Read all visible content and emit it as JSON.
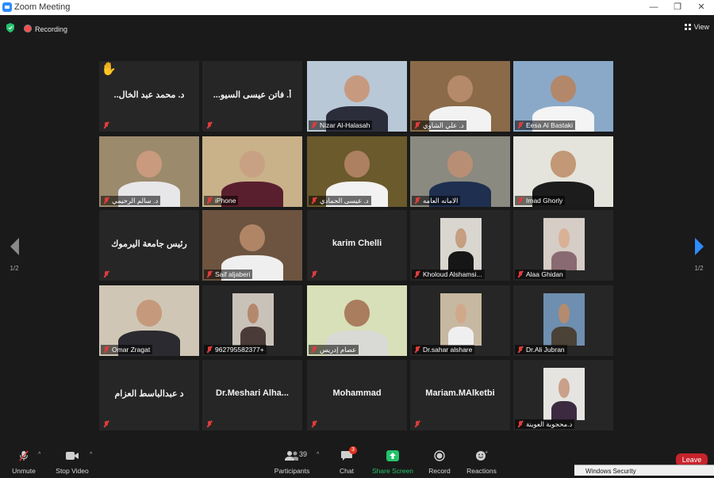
{
  "window": {
    "title": "Zoom Meeting",
    "controls": [
      "—",
      "❐",
      "✕"
    ]
  },
  "topbar": {
    "recording": "Recording",
    "view": "View"
  },
  "pager": {
    "left": "1/2",
    "right": "1/2"
  },
  "tiles": [
    {
      "name": "..د. محمد عبد الخال",
      "label": "",
      "kind": "name",
      "hand": true
    },
    {
      "name": "...أ. فاتن عيسى السيو",
      "label": "",
      "kind": "name"
    },
    {
      "name": "",
      "label": "Nizar Al-Halasah",
      "kind": "video",
      "bg": "#b9c8d6",
      "skin": "#c79a80",
      "suit": "#2b2e3a"
    },
    {
      "name": "",
      "label": "د. علي الشاوي",
      "kind": "video",
      "bg": "#8a6a48",
      "skin": "#b58a6a",
      "suit": "#f2f2f2"
    },
    {
      "name": "",
      "label": "Eesa Al Bastaki",
      "kind": "video",
      "bg": "#8aa9c8",
      "skin": "#b3876a",
      "suit": "#f4f4f4"
    },
    {
      "name": "",
      "label": "د. سالم الرحيمي",
      "kind": "video",
      "bg": "#9c8a6c",
      "skin": "#c99a7e",
      "suit": "#e7e7ea"
    },
    {
      "name": "",
      "label": "iPhone",
      "kind": "video",
      "bg": "#c9b28a",
      "skin": "#c8a184",
      "suit": "#5a1f2e"
    },
    {
      "name": "",
      "label": "د. عيسى الحمادي",
      "kind": "video",
      "bg": "#6b5a2c",
      "skin": "#ad8062",
      "suit": "#f2f2f2"
    },
    {
      "name": "",
      "label": "الامانه العامه",
      "kind": "video",
      "bg": "#8a8a80",
      "skin": "#b88f74",
      "suit": "#1f2f4f"
    },
    {
      "name": "",
      "label": "Imad Ghorly",
      "kind": "video",
      "bg": "#e4e4dc",
      "skin": "#c29877",
      "suit": "#1c1c1c"
    },
    {
      "name": "رئيس جامعة اليرموك",
      "label": "",
      "kind": "name"
    },
    {
      "name": "",
      "label": "Saif aljaberi",
      "kind": "video",
      "bg": "#6d5440",
      "skin": "#b08566",
      "suit": "#efefef",
      "active": true
    },
    {
      "name": "karim Chelli",
      "label": "",
      "kind": "name"
    },
    {
      "name": "",
      "label": "Kholoud Alshamsi...",
      "kind": "photo",
      "bg": "#d8d6cf",
      "skin": "#c69e80",
      "suit": "#161616"
    },
    {
      "name": "",
      "label": "Alaa Ghidan",
      "kind": "photo",
      "bg": "#d6cdc6",
      "skin": "#d8b196",
      "suit": "#8a6a72"
    },
    {
      "name": "",
      "label": "Omar Zragat",
      "kind": "video",
      "bg": "#d0c6b5",
      "skin": "#c59a7c",
      "suit": "#2a2a30"
    },
    {
      "name": "",
      "label": "962795582377+",
      "kind": "photo",
      "bg": "#c9c2b8",
      "skin": "#b4886c",
      "suit": "#4b3b38"
    },
    {
      "name": "",
      "label": "عصام إدريس",
      "kind": "video",
      "bg": "#d7e0b8",
      "skin": "#a97d5e",
      "suit": "#d9d9d6"
    },
    {
      "name": "",
      "label": "Dr.sahar alshare",
      "kind": "photo",
      "bg": "#c7b8a2",
      "skin": "#d0a98a",
      "suit": "#efefef"
    },
    {
      "name": "",
      "label": "Dr.Ali Jubran",
      "kind": "photo",
      "bg": "#6f8fb0",
      "skin": "#b48b6e",
      "suit": "#4a4236"
    },
    {
      "name": "د عبدالباسط العزام",
      "label": "",
      "kind": "name"
    },
    {
      "name": "Dr.Meshari Alha...",
      "label": "",
      "kind": "name"
    },
    {
      "name": "Mohammad",
      "label": "",
      "kind": "name"
    },
    {
      "name": "Mariam.MAlketbi",
      "label": "",
      "kind": "name"
    },
    {
      "name": "",
      "label": "د.محجوبة العوينة",
      "kind": "photo",
      "bg": "#e6e4e0",
      "skin": "#c9a08a",
      "suit": "#3c2a40"
    }
  ],
  "toolbar": {
    "unmute": "Unmute",
    "stop_video": "Stop Video",
    "participants": "Participants",
    "participant_count": "39",
    "chat": "Chat",
    "chat_badge": "3",
    "share": "Share Screen",
    "record": "Record",
    "reactions": "Reactions",
    "leave": "Leave"
  },
  "windows_security": "Windows Security"
}
